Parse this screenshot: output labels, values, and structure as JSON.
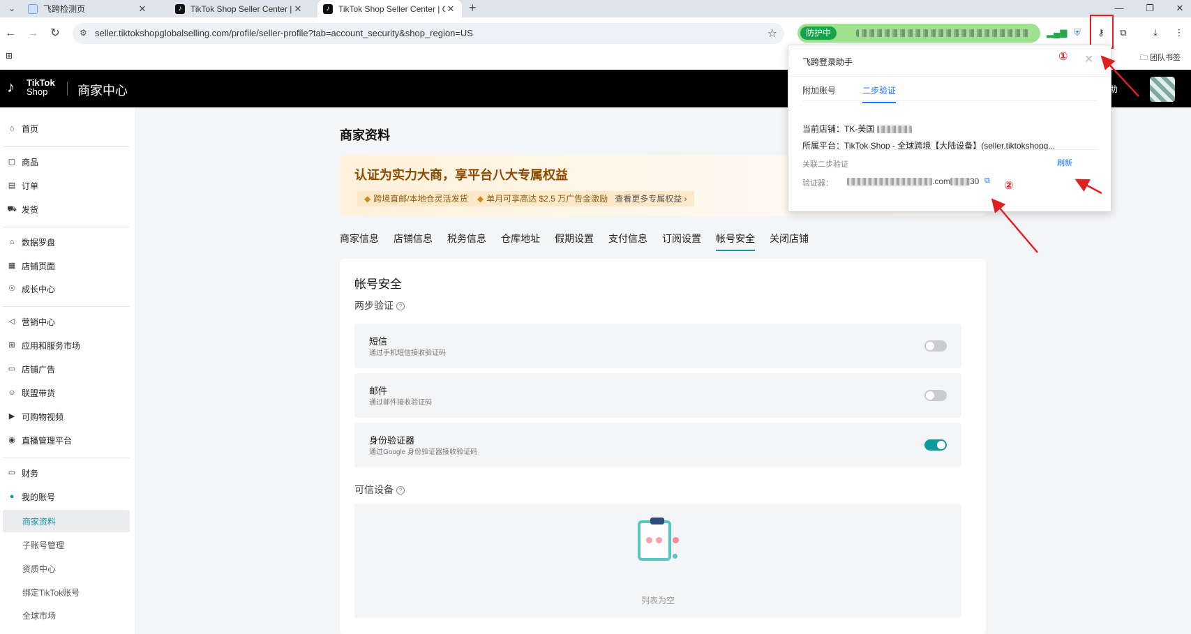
{
  "browser": {
    "tabs": [
      {
        "label": "飞跨检测页",
        "active": false
      },
      {
        "label": "TikTok Shop Seller Center | C",
        "active": false
      },
      {
        "label": "TikTok Shop Seller Center | C",
        "active": true
      }
    ],
    "url": "seller.tiktokshopglobalselling.com/profile/seller-profile?tab=account_security&shop_region=US",
    "protect_badge": "防护中",
    "bookmark_team": "团队书签"
  },
  "header": {
    "logo_line1": "TikTok",
    "logo_line2": "Shop",
    "center_title": "商家中心",
    "help_partial": "助"
  },
  "sidebar": {
    "groups": [
      [
        {
          "label": "首页",
          "icon": "home-icon"
        }
      ],
      [
        {
          "label": "商品",
          "icon": "product-icon"
        },
        {
          "label": "订单",
          "icon": "order-icon"
        },
        {
          "label": "发货",
          "icon": "shipping-icon"
        }
      ],
      [
        {
          "label": "数据罗盘",
          "icon": "compass-icon"
        },
        {
          "label": "店铺页面",
          "icon": "store-icon"
        },
        {
          "label": "成长中心",
          "icon": "growth-icon"
        }
      ],
      [
        {
          "label": "营销中心",
          "icon": "marketing-icon"
        },
        {
          "label": "应用和服务市场",
          "icon": "apps-icon"
        },
        {
          "label": "店铺广告",
          "icon": "ads-icon"
        },
        {
          "label": "联盟带货",
          "icon": "affiliate-icon"
        },
        {
          "label": "可购物视频",
          "icon": "video-icon"
        },
        {
          "label": "直播管理平台",
          "icon": "live-icon"
        }
      ],
      [
        {
          "label": "财务",
          "icon": "finance-icon"
        },
        {
          "label": "我的账号",
          "icon": "account-icon"
        }
      ]
    ],
    "sub_items": [
      "商家资料",
      "子账号管理",
      "资质中心",
      "绑定TikTok账号",
      "全球市场"
    ]
  },
  "main": {
    "page_title": "商家资料",
    "promo": {
      "title": "认证为实力大商，享平台八大专属权益",
      "benefit1": "跨境直邮/本地仓灵活发货",
      "benefit2": "单月可享高达 $2.5 万广告金激励",
      "more": "查看更多专属权益 ›"
    },
    "tabs": [
      "商家信息",
      "店铺信息",
      "税务信息",
      "仓库地址",
      "假期设置",
      "支付信息",
      "订阅设置",
      "帐号安全",
      "关闭店铺"
    ],
    "selected_tab": "帐号安全",
    "card_title": "帐号安全",
    "two_step_title": "两步验证",
    "options": [
      {
        "title": "短信",
        "desc": "通过手机短信接收验证码",
        "enabled": false
      },
      {
        "title": "邮件",
        "desc": "通过邮件接收验证码",
        "enabled": false
      },
      {
        "title": "身份验证器",
        "desc": "通过Google 身份验证器接收验证码",
        "enabled": true
      }
    ],
    "trusted_title": "可信设备",
    "empty_text": "列表为空"
  },
  "popup": {
    "title": "飞跨登录助手",
    "tabs": [
      "附加账号",
      "二步验证"
    ],
    "selected_tab": "二步验证",
    "current_store_label": "当前店铺：",
    "current_store_value": "TK-美国",
    "platform_label": "所属平台：",
    "platform_value": "TikTok Shop - 全球跨境【大陆设备】(seller.tiktokshopg...",
    "linked_label": "关联二步验证",
    "refresh": "刷新",
    "auth_label": "验证器：",
    "auth_suffix": ".com",
    "code_suffix": "30"
  },
  "annotations": {
    "one": "①",
    "two": "②"
  },
  "colors": {
    "accent": "#0f9aa0",
    "link": "#1677ff",
    "annotation": "#e02020"
  }
}
